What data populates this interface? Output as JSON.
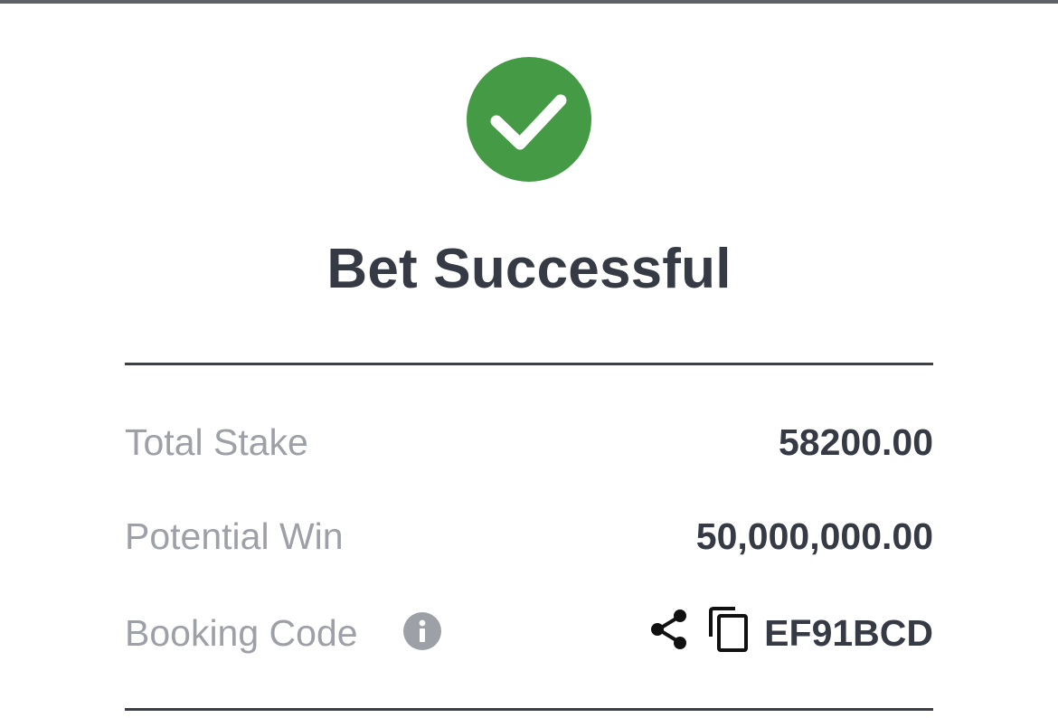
{
  "header": {
    "title": "Bet Successful",
    "status_icon": "check-circle-icon",
    "status_color": "#459a45"
  },
  "summary": {
    "total_stake": {
      "label": "Total Stake",
      "value": "58200.00"
    },
    "potential_win": {
      "label": "Potential Win",
      "value": "50,000,000.00"
    },
    "booking_code": {
      "label": "Booking Code",
      "value": "EF91BCD",
      "info_icon": "info-icon",
      "share_icon": "share-icon",
      "copy_icon": "copy-icon"
    }
  }
}
